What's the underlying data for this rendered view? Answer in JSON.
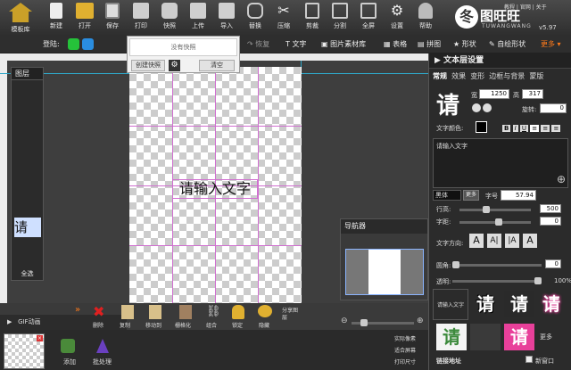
{
  "toolbar": {
    "home": "模板库",
    "new": "新建",
    "open": "打开",
    "save": "保存",
    "print": "打印",
    "snapshot": "快照",
    "upload": "上传",
    "import": "导入",
    "replace": "替换",
    "compress": "压缩",
    "crop": "裁切",
    "trim": "剪裁",
    "split": "分割",
    "fullscreen": "全屏",
    "settings": "设置",
    "help": "帮助"
  },
  "brand": {
    "logo_glyph": "冬",
    "name": "图旺旺",
    "sub": "TUWANGWANG",
    "links": "教程 | 官网 | 关于",
    "version": "v5.97"
  },
  "row2": {
    "login": "登陆:",
    "redo": "恢复",
    "text": "文字",
    "image_lib": "图片素材库",
    "table": "表格",
    "puzzle": "拼图",
    "shape": "形状",
    "custom_shape": "自绘形状",
    "more": "更多"
  },
  "snapshot_panel": {
    "empty": "没有快照",
    "create": "创建快照",
    "clear": "清空"
  },
  "layers": {
    "title": "图层",
    "thumb_glyph": "请",
    "select_all": "全选"
  },
  "canvas": {
    "placeholder": "请输入文字"
  },
  "navigator": {
    "title": "导航器"
  },
  "bottom": {
    "gif": "GIF动画",
    "delete": "删除",
    "copy": "复制",
    "move": "移动到",
    "rasterize": "栅格化",
    "group": "组合",
    "lock": "锁定",
    "hide": "隐藏",
    "share_image": "分享图层"
  },
  "timeline": {
    "add": "添加",
    "batch": "批处理",
    "actual_pixels": "实际像素",
    "fit_screen": "适合屏幕",
    "print_size": "打印尺寸"
  },
  "right": {
    "title": "文本层设置",
    "tabs": [
      "常规",
      "效果",
      "变形",
      "边框与背景",
      "蒙版"
    ],
    "big_glyph": "请",
    "width_label": "宽",
    "width": "1250",
    "height_label": "高",
    "height": "317",
    "rotate_label": "旋转:",
    "rotate": "0",
    "color_label": "文字颜色:",
    "text_value": "请输入文字",
    "font": "黑体",
    "more_fonts": "更多",
    "size_label": "字号",
    "size": "57.94",
    "line_label": "行高:",
    "line": "500",
    "char_label": "字距:",
    "char": "0",
    "dir_label": "文字方向:",
    "dirs": [
      "A",
      "A|",
      "|A",
      "A"
    ],
    "corner_label": "圆角:",
    "corner": "0",
    "opacity_label": "透明:",
    "opacity": "100%",
    "styles_label": "请输入文字",
    "style_glyph": "请",
    "style_more": "更多",
    "link_label": "链接地址",
    "new_window": "新窗口"
  },
  "colors": {
    "accent": "#ff7a1a",
    "pink": "#e8409a",
    "green": "#3c8a3c"
  }
}
